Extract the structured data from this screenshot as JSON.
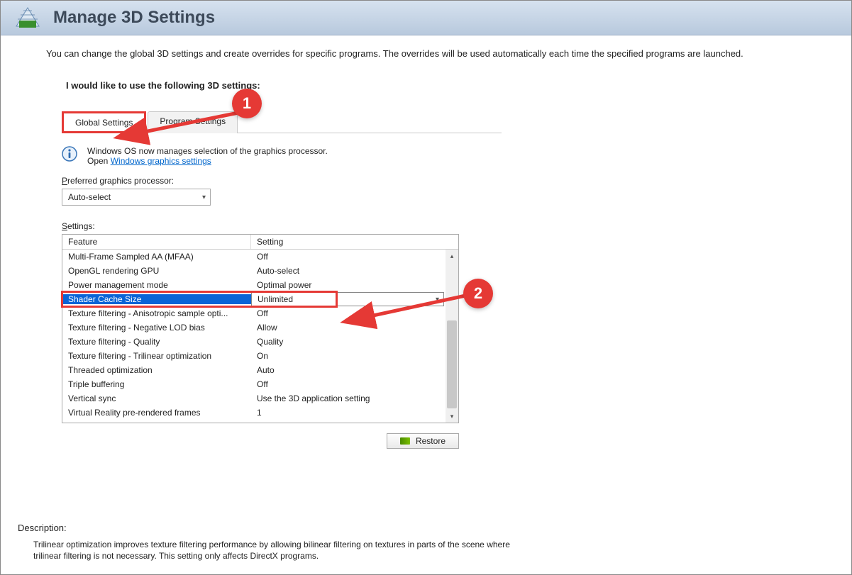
{
  "header": {
    "title": "Manage 3D Settings"
  },
  "intro": "You can change the global 3D settings and create overrides for specific programs. The overrides will be used automatically each time the specified programs are launched.",
  "group_label": "I would like to use the following 3D settings:",
  "tabs": {
    "global": "Global Settings",
    "program": "Program Settings"
  },
  "info": {
    "line1": "Windows OS now manages selection of the graphics processor.",
    "line2_prefix": "Open ",
    "link": "Windows graphics settings"
  },
  "preferred": {
    "label_pre": "P",
    "label_rest": "referred graphics processor:",
    "value": "Auto-select"
  },
  "settings": {
    "label_pre": "S",
    "label_rest": "ettings:",
    "col_feature": "Feature",
    "col_setting": "Setting",
    "rows": [
      {
        "feature": "Multi-Frame Sampled AA (MFAA)",
        "value": "Off"
      },
      {
        "feature": "OpenGL rendering GPU",
        "value": "Auto-select"
      },
      {
        "feature": "Power management mode",
        "value": "Optimal power"
      },
      {
        "feature": "Shader Cache Size",
        "value": "Unlimited",
        "selected": true
      },
      {
        "feature": "Texture filtering - Anisotropic sample opti...",
        "value": "Off"
      },
      {
        "feature": "Texture filtering - Negative LOD bias",
        "value": "Allow"
      },
      {
        "feature": "Texture filtering - Quality",
        "value": "Quality"
      },
      {
        "feature": "Texture filtering - Trilinear optimization",
        "value": "On"
      },
      {
        "feature": "Threaded optimization",
        "value": "Auto"
      },
      {
        "feature": "Triple buffering",
        "value": "Off"
      },
      {
        "feature": "Vertical sync",
        "value": "Use the 3D application setting"
      },
      {
        "feature": "Virtual Reality pre-rendered frames",
        "value": "1"
      }
    ]
  },
  "restore_label": "Restore",
  "description": {
    "label": "Description:",
    "text": "Trilinear optimization improves texture filtering performance by allowing bilinear filtering on textures in parts of the scene where trilinear filtering is not necessary. This setting only affects DirectX programs."
  },
  "annotations": {
    "badge1": "1",
    "badge2": "2"
  }
}
